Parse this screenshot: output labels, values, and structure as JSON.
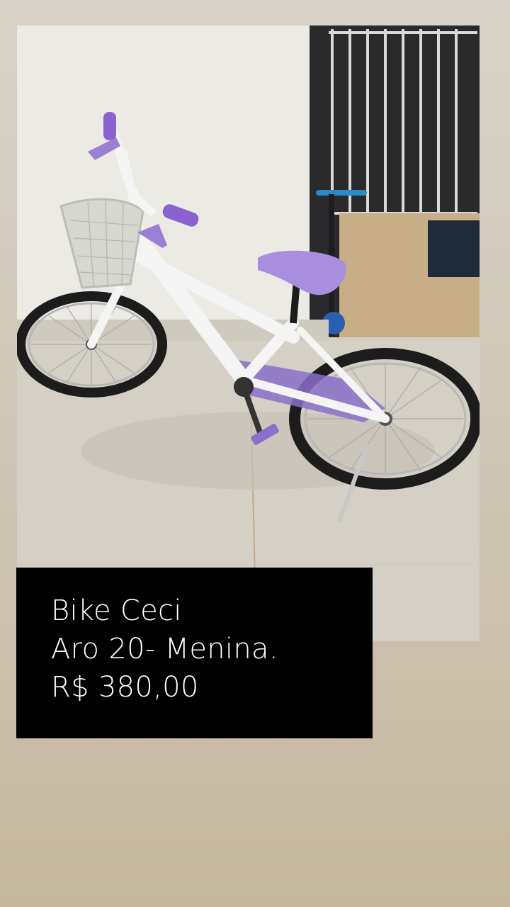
{
  "story": {
    "caption_lines": [
      "Bike Ceci",
      "Aro 20- Menina.",
      "R$ 380,00"
    ]
  },
  "photo": {
    "subject": "children's bicycle (white frame, purple saddle and grips, front wire basket)"
  },
  "colors": {
    "background_top": "#d8d3c8",
    "background_bottom": "#c4b79d",
    "caption_background": "#000000",
    "caption_text": "#ffffff",
    "bike_accent": "#9b7fd4"
  }
}
